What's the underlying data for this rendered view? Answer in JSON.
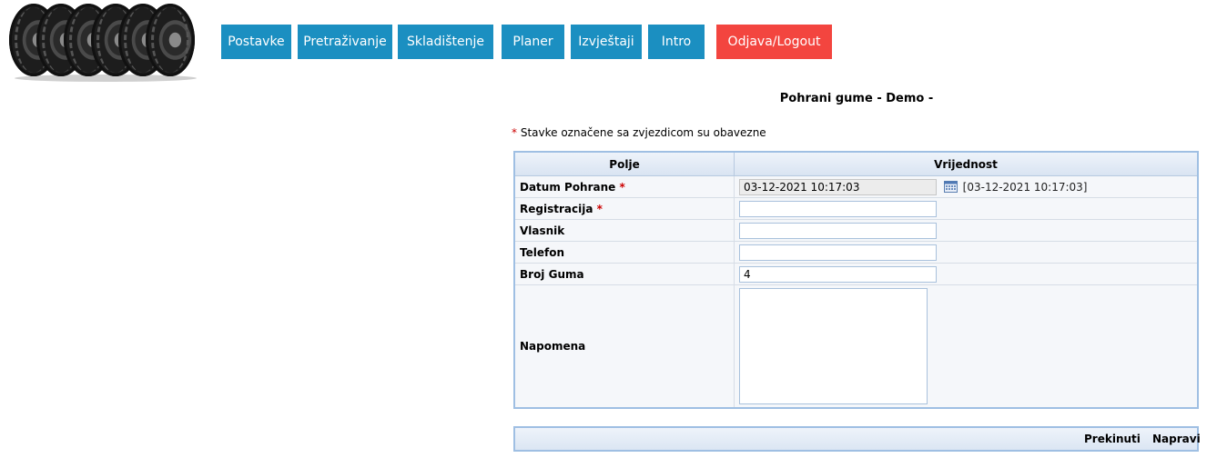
{
  "nav": {
    "items": [
      {
        "label": "Postavke"
      },
      {
        "label": "Pretraživanje"
      },
      {
        "label": "Skladištenje"
      },
      {
        "label": "Planer"
      },
      {
        "label": "Izvještaji"
      },
      {
        "label": "Intro"
      }
    ],
    "logout_label": "Odjava/Logout",
    "accent": "#1b8fc1",
    "logout_color": "#f3453f"
  },
  "page": {
    "title": "Pohrani gume - Demo -",
    "required_star": "*",
    "required_note": "Stavke označene sa zvjezdicom su obavezne"
  },
  "table": {
    "header_field": "Polje",
    "header_value": "Vrijednost",
    "rows": {
      "datum_pohrane": {
        "label": "Datum Pohrane",
        "value": "03-12-2021 10:17:03",
        "display": "[03-12-2021 10:17:03]"
      },
      "registracija": {
        "label": "Registracija",
        "value": ""
      },
      "vlasnik": {
        "label": "Vlasnik",
        "value": ""
      },
      "telefon": {
        "label": "Telefon",
        "value": ""
      },
      "broj_guma": {
        "label": "Broj Guma",
        "value": "4"
      },
      "napomena": {
        "label": "Napomena",
        "value": ""
      }
    }
  },
  "footer": {
    "cancel_label": "Prekinuti",
    "submit_label": "Napravi"
  },
  "icons": {
    "calendar": "calendar-icon",
    "logo": "tyres-logo"
  }
}
